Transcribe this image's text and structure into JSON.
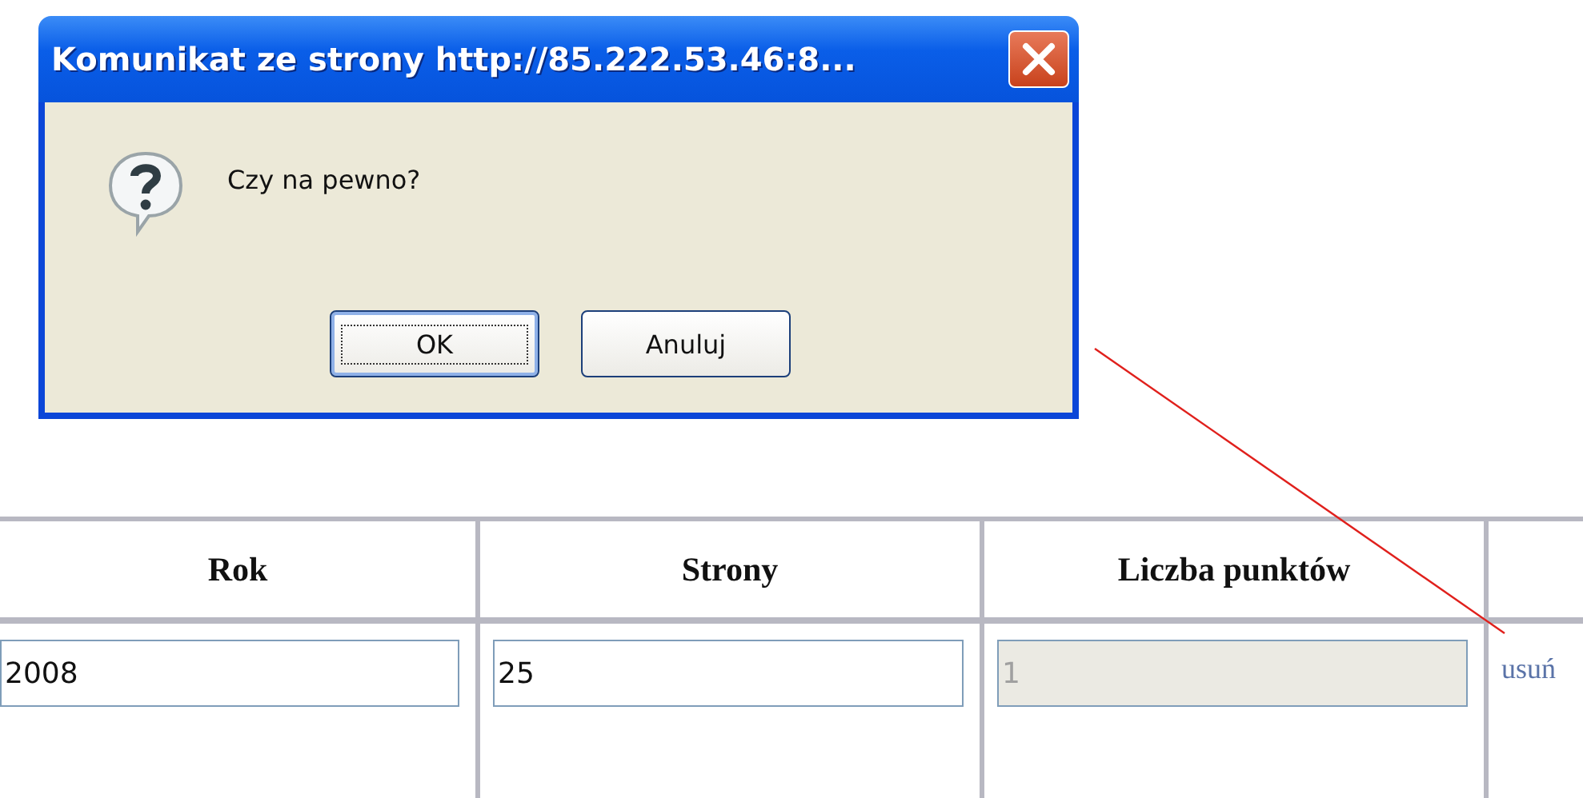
{
  "dialog": {
    "title": "Komunikat ze strony http://85.222.53.46:8...",
    "message": "Czy na pewno?",
    "buttons": [
      {
        "label": "OK",
        "default": true
      },
      {
        "label": "Anuluj",
        "default": false
      }
    ]
  },
  "table": {
    "columns": [
      "Rok",
      "Strony",
      "Liczba punktów",
      ""
    ],
    "rows": [
      {
        "fields": [
          {
            "value": "2008",
            "disabled": false
          },
          {
            "value": "25",
            "disabled": false
          },
          {
            "value": "1",
            "disabled": true
          }
        ],
        "link": "usuń"
      }
    ]
  }
}
